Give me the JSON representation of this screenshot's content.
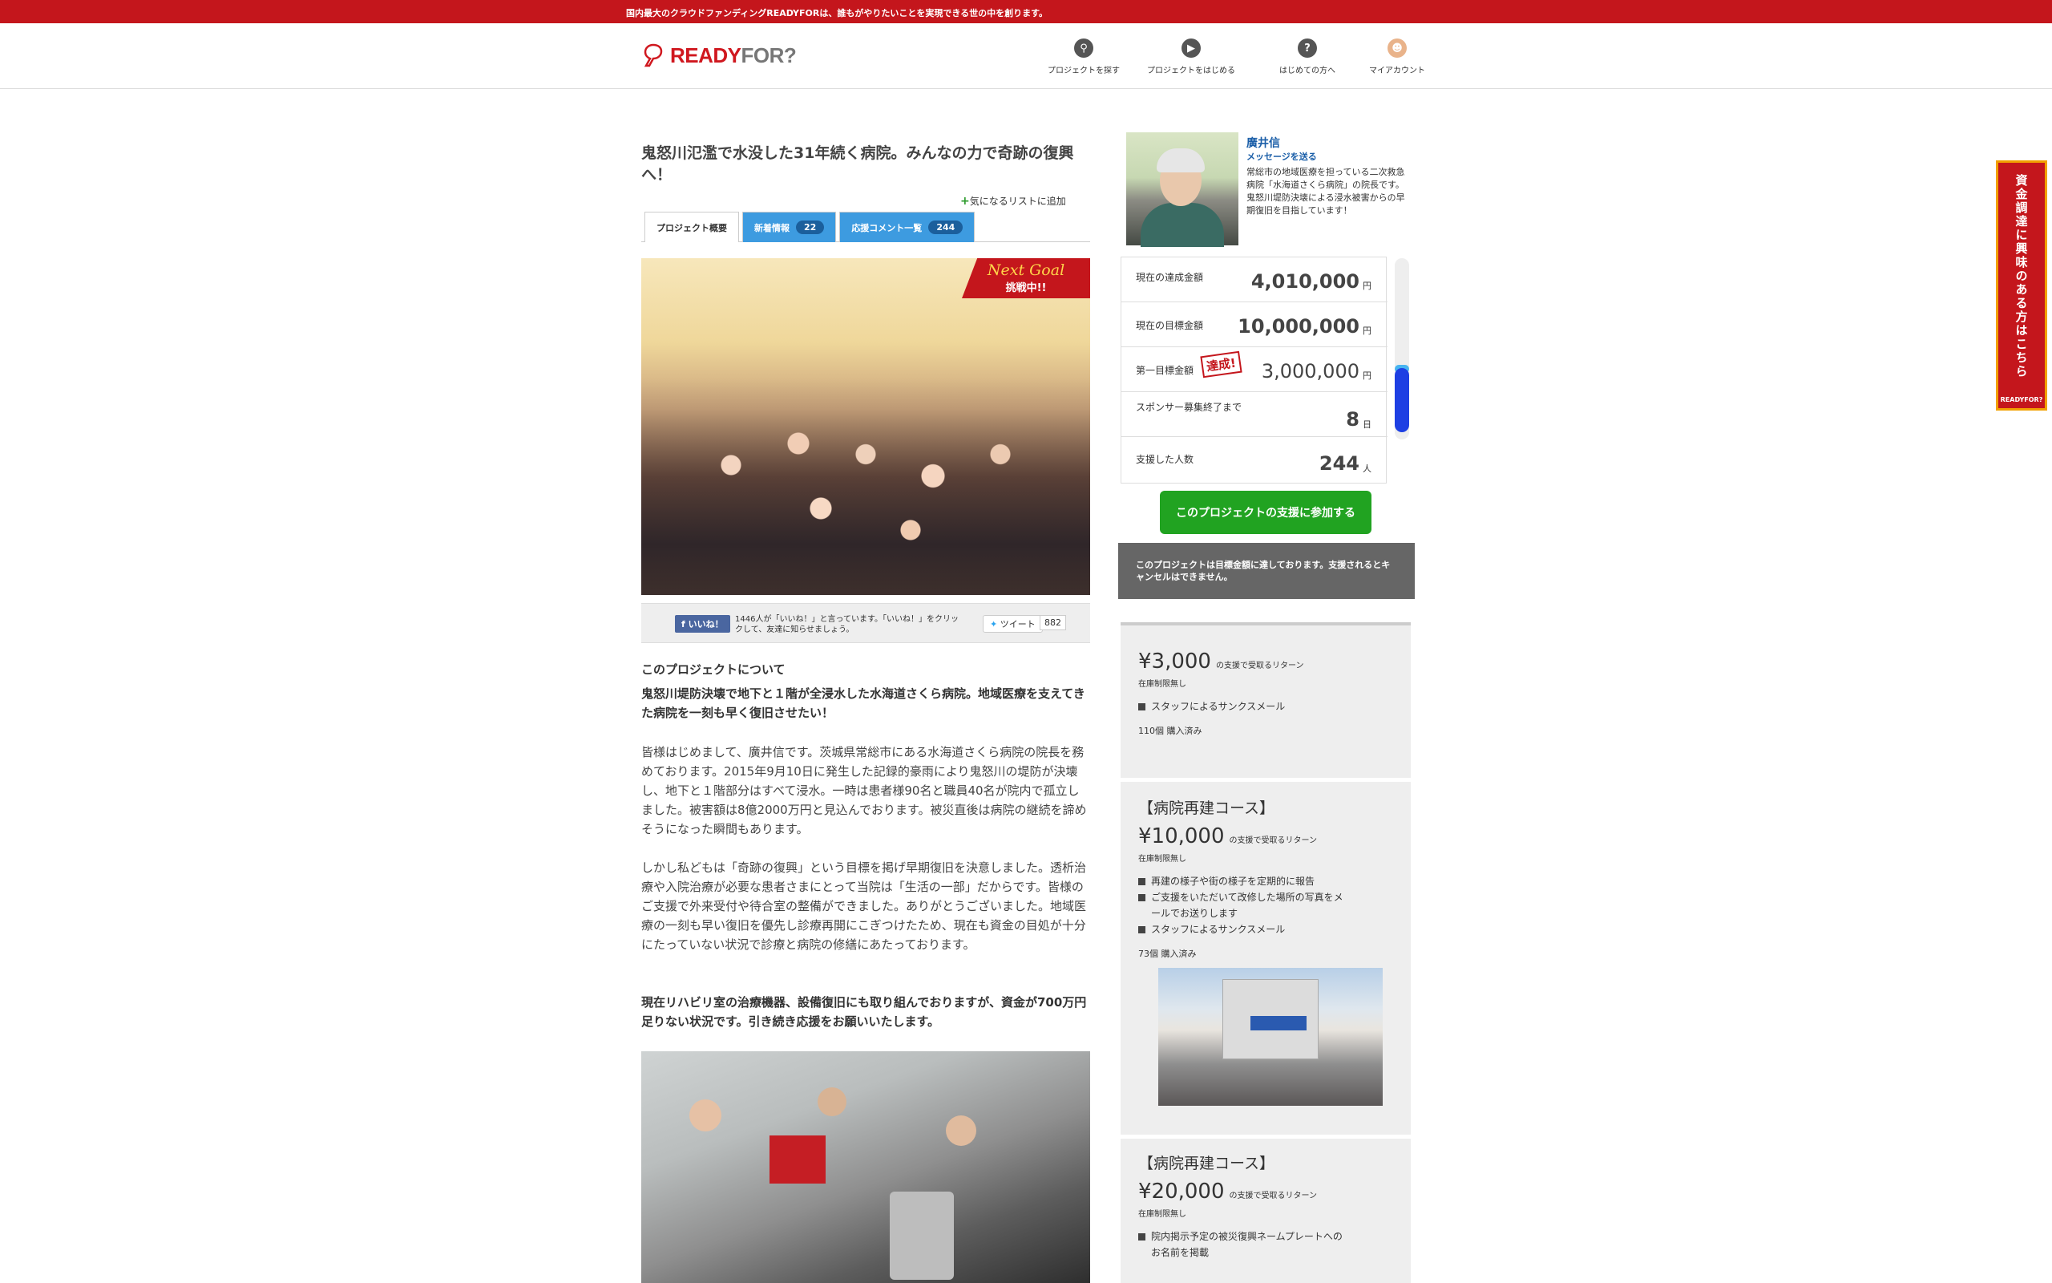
{
  "topbar": {
    "text": "国内最大のクラウドファンディングREADYFORは、誰もがやりたいことを実現できる世の中を創ります。"
  },
  "logo": {
    "text_ready": "READY",
    "text_for": "FOR?"
  },
  "nav": [
    {
      "label": "プロジェクトを探す",
      "icon": "search-icon"
    },
    {
      "label": "プロジェクトをはじめる",
      "icon": "play-icon"
    },
    {
      "label": "はじめての方へ",
      "icon": "help-icon"
    },
    {
      "label": "マイアカウント",
      "icon": "avatar-icon"
    }
  ],
  "project": {
    "title": "鬼怒川氾濫で水没した31年続く病院。みんなの力で奇跡の復興へ！",
    "favorite": "気になるリストに追加",
    "tabs": [
      {
        "label": "プロジェクト概要",
        "count": ""
      },
      {
        "label": "新着情報",
        "count": "22"
      },
      {
        "label": "応援コメント一覧",
        "count": "244"
      }
    ],
    "ribbon_top": "Next Goal",
    "ribbon_bottom": "挑戦中!!"
  },
  "social": {
    "like_label": "いいね！",
    "like_text": "1446人が「いいね！」と言っています。「いいね！」をクリックして、友達に知らせましょう。",
    "tweet_label": "ツイート",
    "tweet_count": "882"
  },
  "content": {
    "heading": "このプロジェクトについて",
    "lead": "鬼怒川堤防決壊で地下と１階が全浸水した水海道さくら病院。地域医療を支えてきた病院を一刻も早く復旧させたい！",
    "p1": "皆様はじめまして、廣井信です。茨城県常総市にある水海道さくら病院の院長を務めております。2015年9月10日に発生した記録的豪雨により鬼怒川の堤防が決壊し、地下と１階部分はすべて浸水。一時は患者様90名と職員40名が院内で孤立しました。被害額は8億2000万円と見込んでおります。被災直後は病院の継続を諦めそうになった瞬間もあります。",
    "p2": "しかし私どもは「奇跡の復興」という目標を掲げ早期復旧を決意しました。透析治療や入院治療が必要な患者さまにとって当院は「生活の一部」だからです。皆様のご支援で外来受付や待合室の整備ができました。ありがとうございました。地域医療の一刻も早い復旧を優先し診療再開にこぎつけたため、現在も資金の目処が十分にたっていない状況で診療と病院の修繕にあたっております。",
    "p3": "現在リハビリ室の治療機器、設備復旧にも取り組んでおりますが、資金が700万円足りない状況です。引き続き応援をお願いいたします。"
  },
  "author": {
    "name": "廣井信",
    "message_link": "メッセージを送る",
    "desc": "常総市の地域医療を担っている二次救急病院「水海道さくら病院」の院長です。鬼怒川堤防決壊による浸水被害からの早期復旧を目指しています！"
  },
  "stats": {
    "current_label": "現在の達成金額",
    "current_value": "4,010,000",
    "yen": "円",
    "goal_label": "現在の目標金額",
    "goal_value": "10,000,000",
    "first_label": "第一目標金額",
    "first_value": "3,000,000",
    "achieved": "達成!",
    "days_label": "スポンサー募集終了まで",
    "days_value": "8",
    "days_unit": "日",
    "backers_label": "支援した人数",
    "backers_value": "244",
    "backers_unit": "人"
  },
  "support_button": "このプロジェクトの支援に参加する",
  "notice": "このプロジェクトは目標金額に達しております。支援されるとキャンセルはできません。",
  "rewards": [
    {
      "course": "",
      "price": "¥3,000",
      "suffix": "の支援で受取るリターン",
      "limit": "在庫制限無し",
      "items": [
        "スタッフによるサンクスメール"
      ],
      "bought": "110個 購入済み"
    },
    {
      "course": "【病院再建コース】",
      "price": "¥10,000",
      "suffix": "の支援で受取るリターン",
      "limit": "在庫制限無し",
      "items": [
        "再建の様子や街の様子を定期的に報告",
        "ご支援をいただいて改修した場所の写真をメールでお送りします",
        "スタッフによるサンクスメール"
      ],
      "bought": "73個 購入済み"
    },
    {
      "course": "【病院再建コース】",
      "price": "¥20,000",
      "suffix": "の支援で受取るリターン",
      "limit": "在庫制限無し",
      "items": [
        "院内掲示予定の被災復興ネームプレートへのお名前を掲載"
      ]
    }
  ],
  "side_banner": {
    "text": "資金調達に興味のある方はこちら",
    "logo": "READYFOR?"
  },
  "colors": {
    "brand_red": "#c4161c",
    "tab_blue": "#3d9be0",
    "support_green": "#21a321"
  }
}
